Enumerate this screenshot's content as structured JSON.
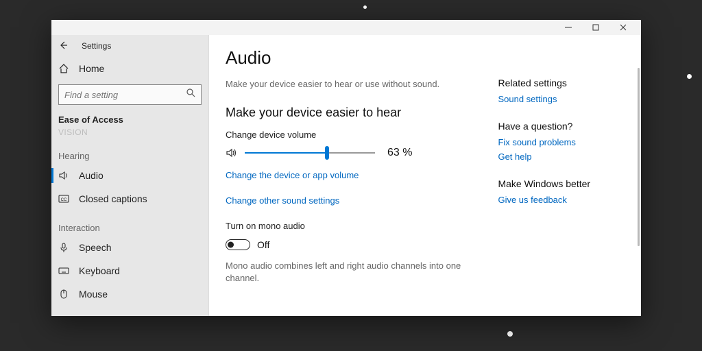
{
  "window": {
    "app_title": "Settings"
  },
  "sidebar": {
    "home_label": "Home",
    "search_placeholder": "Find a setting",
    "category": "Ease of Access",
    "cutoff_item": "Vision",
    "groups": [
      {
        "label": "Hearing",
        "items": [
          {
            "icon": "speaker-icon",
            "label": "Audio",
            "selected": true
          },
          {
            "icon": "cc-icon",
            "label": "Closed captions",
            "selected": false
          }
        ]
      },
      {
        "label": "Interaction",
        "items": [
          {
            "icon": "mic-icon",
            "label": "Speech",
            "selected": false
          },
          {
            "icon": "keyboard-icon",
            "label": "Keyboard",
            "selected": false
          },
          {
            "icon": "mouse-icon",
            "label": "Mouse",
            "selected": false
          }
        ]
      }
    ]
  },
  "main": {
    "title": "Audio",
    "description": "Make your device easier to hear or use without sound.",
    "section_hear": "Make your device easier to hear",
    "volume": {
      "label": "Change device volume",
      "value": 63,
      "display": "63 %"
    },
    "link_app_volume": "Change the device or app volume",
    "link_other_sound": "Change other sound settings",
    "mono": {
      "label": "Turn on mono audio",
      "state": "Off",
      "desc": "Mono audio combines left and right audio channels into one channel."
    }
  },
  "rightpane": {
    "related_hdr": "Related settings",
    "related_link": "Sound settings",
    "question_hdr": "Have a question?",
    "question_links": [
      "Fix sound problems",
      "Get help"
    ],
    "better_hdr": "Make Windows better",
    "better_link": "Give us feedback"
  }
}
